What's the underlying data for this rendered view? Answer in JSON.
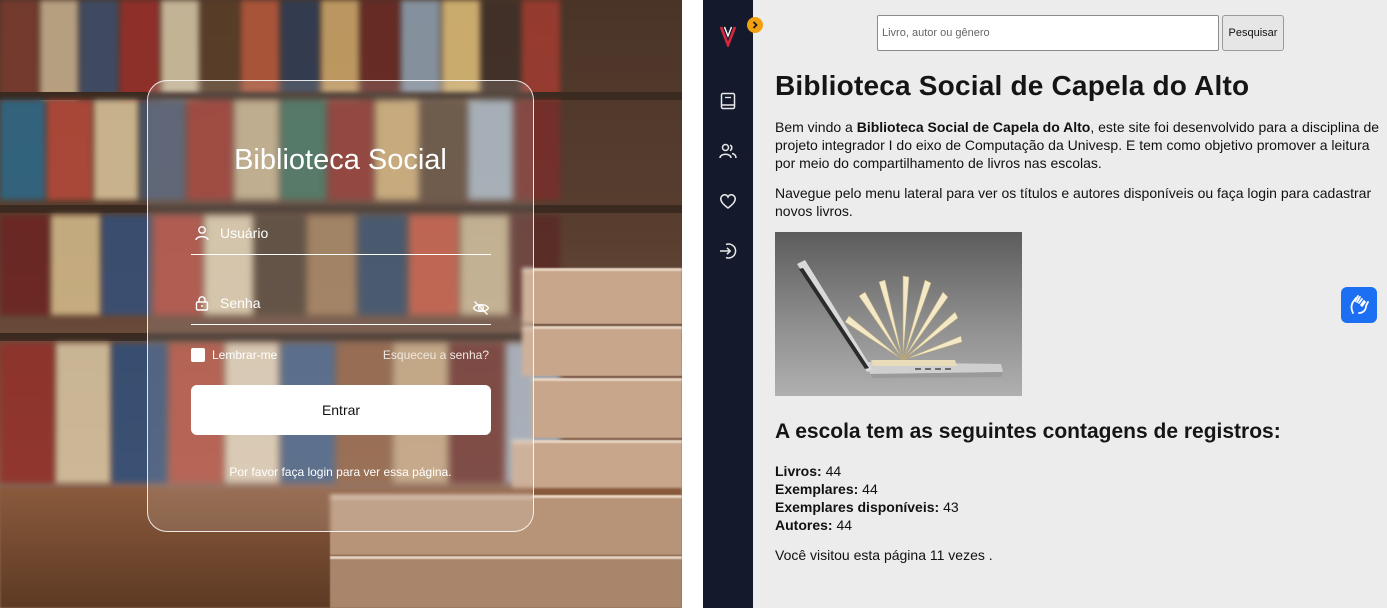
{
  "login": {
    "title": "Biblioteca Social",
    "username_label": "Usuário",
    "password_label": "Senha",
    "remember_label": "Lembrar-me",
    "forgot_label": "Esqueceu a senha?",
    "submit_label": "Entrar",
    "message": "Por favor faça login para ver essa página."
  },
  "site": {
    "search": {
      "placeholder": "Livro, autor ou gênero",
      "button_label": "Pesquisar"
    },
    "title": "Biblioteca Social de Capela do Alto",
    "intro_prefix": "Bem vindo a ",
    "intro_bold": "Biblioteca Social de Capela do Alto",
    "intro_suffix": ", este site foi desenvolvido para a disciplina de projeto integrador I do eixo de Computação da Univesp. E tem como objetivo promover a leitura por meio do compartilhamento de livros nas escolas.",
    "intro2": "Navegue pelo menu lateral para ver os títulos e autores disponíveis ou faça login para cadastrar novos livros.",
    "counts_heading": "A escola tem as seguintes contagens de registros:",
    "counts": [
      {
        "label": "Livros:",
        "value": "44"
      },
      {
        "label": "Exemplares:",
        "value": "44"
      },
      {
        "label": "Exemplares disponíveis:",
        "value": "43"
      },
      {
        "label": "Autores:",
        "value": "44"
      }
    ],
    "visits": "Você visitou esta página 11 vezes ."
  },
  "sidebar": {
    "logo_icon": "v-logo-icon",
    "items": [
      "book-icon",
      "users-icon",
      "heart-icon",
      "login-icon"
    ]
  },
  "colors": {
    "sidebar_bg": "#141a2c",
    "accent": "#f2a00e",
    "a11y_button": "#1c6ef2",
    "logo_red": "#d7263d"
  }
}
